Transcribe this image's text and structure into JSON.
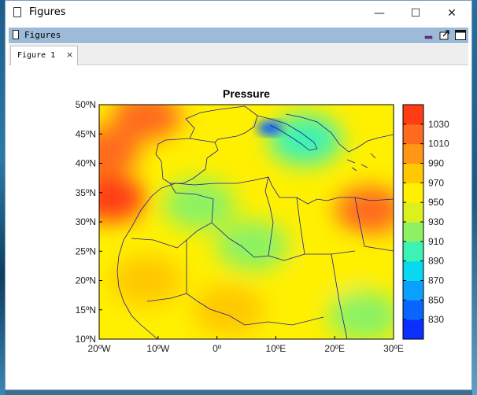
{
  "window": {
    "title": "Figures",
    "minimize_glyph": "—",
    "maximize_glyph": "☐",
    "close_glyph": "✕"
  },
  "panel": {
    "title": "Figures",
    "icons": [
      "minimize-panel-icon",
      "undock-icon",
      "maximize-panel-icon"
    ]
  },
  "tabs": [
    {
      "label": "Figure 1",
      "close": "×"
    }
  ],
  "chart_data": {
    "type": "heatmap",
    "title": "Pressure",
    "xlabel": "",
    "ylabel": "",
    "x_ticks": [
      "20ºW",
      "10ºW",
      "0º",
      "10ºE",
      "20ºE",
      "30ºE"
    ],
    "y_ticks": [
      "10ºN",
      "15ºN",
      "20ºN",
      "25ºN",
      "30ºN",
      "35ºN",
      "40ºN",
      "45ºN",
      "50ºN"
    ],
    "xlim": [
      -20,
      30
    ],
    "ylim": [
      10,
      50
    ],
    "colorbar": {
      "labels": [
        "830",
        "850",
        "870",
        "890",
        "910",
        "930",
        "950",
        "970",
        "990",
        "1010",
        "1030"
      ],
      "colors": [
        "#0a2fff",
        "#0a64ff",
        "#0aa0ff",
        "#08d8f0",
        "#3cf2b4",
        "#8cf264",
        "#dcf01e",
        "#fff000",
        "#ffc800",
        "#ff9614",
        "#ff6a1e",
        "#ff3c14"
      ]
    },
    "pressure_regions": [
      {
        "lon": -18,
        "lat": 34,
        "value": 1030
      },
      {
        "lon": -19,
        "lat": 42,
        "value": 1015
      },
      {
        "lon": -12,
        "lat": 48,
        "value": 1005
      },
      {
        "lon": 26,
        "lat": 32,
        "value": 1015
      },
      {
        "lon": 9,
        "lat": 46,
        "value": 840
      },
      {
        "lon": -3,
        "lat": 33,
        "value": 920
      },
      {
        "lon": 6,
        "lat": 26,
        "value": 925
      },
      {
        "lon": 25,
        "lat": 14,
        "value": 920
      },
      {
        "lon": 15,
        "lat": 44,
        "value": 910
      },
      {
        "lon": 2,
        "lat": 15,
        "value": 975
      },
      {
        "lon": -12,
        "lat": 20,
        "value": 970
      },
      {
        "lon": 20,
        "lat": 22,
        "value": 960
      }
    ]
  }
}
